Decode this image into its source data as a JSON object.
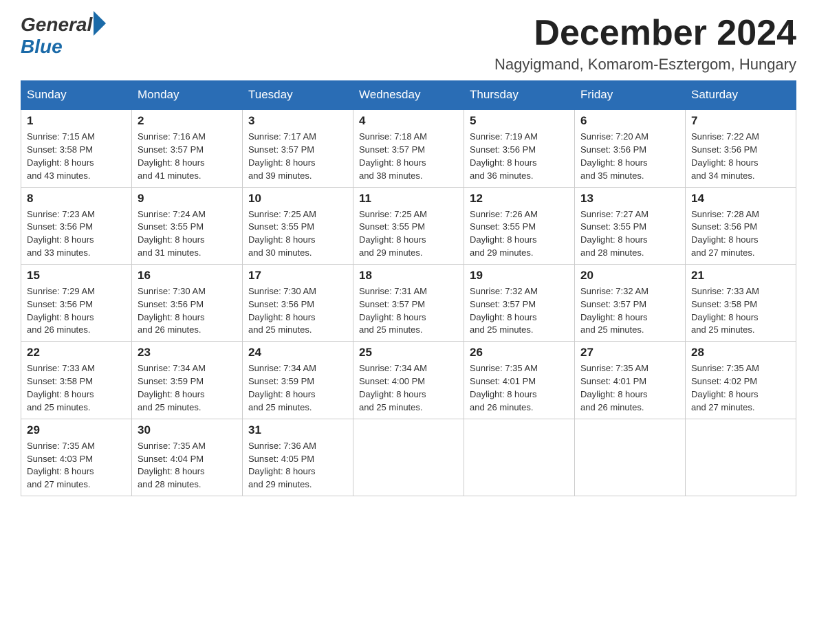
{
  "header": {
    "logo_general": "General",
    "logo_blue": "Blue",
    "month_title": "December 2024",
    "location": "Nagyigmand, Komarom-Esztergom, Hungary"
  },
  "weekdays": [
    "Sunday",
    "Monday",
    "Tuesday",
    "Wednesday",
    "Thursday",
    "Friday",
    "Saturday"
  ],
  "weeks": [
    [
      {
        "day": "1",
        "sunrise": "7:15 AM",
        "sunset": "3:58 PM",
        "daylight": "8 hours and 43 minutes."
      },
      {
        "day": "2",
        "sunrise": "7:16 AM",
        "sunset": "3:57 PM",
        "daylight": "8 hours and 41 minutes."
      },
      {
        "day": "3",
        "sunrise": "7:17 AM",
        "sunset": "3:57 PM",
        "daylight": "8 hours and 39 minutes."
      },
      {
        "day": "4",
        "sunrise": "7:18 AM",
        "sunset": "3:57 PM",
        "daylight": "8 hours and 38 minutes."
      },
      {
        "day": "5",
        "sunrise": "7:19 AM",
        "sunset": "3:56 PM",
        "daylight": "8 hours and 36 minutes."
      },
      {
        "day": "6",
        "sunrise": "7:20 AM",
        "sunset": "3:56 PM",
        "daylight": "8 hours and 35 minutes."
      },
      {
        "day": "7",
        "sunrise": "7:22 AM",
        "sunset": "3:56 PM",
        "daylight": "8 hours and 34 minutes."
      }
    ],
    [
      {
        "day": "8",
        "sunrise": "7:23 AM",
        "sunset": "3:56 PM",
        "daylight": "8 hours and 33 minutes."
      },
      {
        "day": "9",
        "sunrise": "7:24 AM",
        "sunset": "3:55 PM",
        "daylight": "8 hours and 31 minutes."
      },
      {
        "day": "10",
        "sunrise": "7:25 AM",
        "sunset": "3:55 PM",
        "daylight": "8 hours and 30 minutes."
      },
      {
        "day": "11",
        "sunrise": "7:25 AM",
        "sunset": "3:55 PM",
        "daylight": "8 hours and 29 minutes."
      },
      {
        "day": "12",
        "sunrise": "7:26 AM",
        "sunset": "3:55 PM",
        "daylight": "8 hours and 29 minutes."
      },
      {
        "day": "13",
        "sunrise": "7:27 AM",
        "sunset": "3:55 PM",
        "daylight": "8 hours and 28 minutes."
      },
      {
        "day": "14",
        "sunrise": "7:28 AM",
        "sunset": "3:56 PM",
        "daylight": "8 hours and 27 minutes."
      }
    ],
    [
      {
        "day": "15",
        "sunrise": "7:29 AM",
        "sunset": "3:56 PM",
        "daylight": "8 hours and 26 minutes."
      },
      {
        "day": "16",
        "sunrise": "7:30 AM",
        "sunset": "3:56 PM",
        "daylight": "8 hours and 26 minutes."
      },
      {
        "day": "17",
        "sunrise": "7:30 AM",
        "sunset": "3:56 PM",
        "daylight": "8 hours and 25 minutes."
      },
      {
        "day": "18",
        "sunrise": "7:31 AM",
        "sunset": "3:57 PM",
        "daylight": "8 hours and 25 minutes."
      },
      {
        "day": "19",
        "sunrise": "7:32 AM",
        "sunset": "3:57 PM",
        "daylight": "8 hours and 25 minutes."
      },
      {
        "day": "20",
        "sunrise": "7:32 AM",
        "sunset": "3:57 PM",
        "daylight": "8 hours and 25 minutes."
      },
      {
        "day": "21",
        "sunrise": "7:33 AM",
        "sunset": "3:58 PM",
        "daylight": "8 hours and 25 minutes."
      }
    ],
    [
      {
        "day": "22",
        "sunrise": "7:33 AM",
        "sunset": "3:58 PM",
        "daylight": "8 hours and 25 minutes."
      },
      {
        "day": "23",
        "sunrise": "7:34 AM",
        "sunset": "3:59 PM",
        "daylight": "8 hours and 25 minutes."
      },
      {
        "day": "24",
        "sunrise": "7:34 AM",
        "sunset": "3:59 PM",
        "daylight": "8 hours and 25 minutes."
      },
      {
        "day": "25",
        "sunrise": "7:34 AM",
        "sunset": "4:00 PM",
        "daylight": "8 hours and 25 minutes."
      },
      {
        "day": "26",
        "sunrise": "7:35 AM",
        "sunset": "4:01 PM",
        "daylight": "8 hours and 26 minutes."
      },
      {
        "day": "27",
        "sunrise": "7:35 AM",
        "sunset": "4:01 PM",
        "daylight": "8 hours and 26 minutes."
      },
      {
        "day": "28",
        "sunrise": "7:35 AM",
        "sunset": "4:02 PM",
        "daylight": "8 hours and 27 minutes."
      }
    ],
    [
      {
        "day": "29",
        "sunrise": "7:35 AM",
        "sunset": "4:03 PM",
        "daylight": "8 hours and 27 minutes."
      },
      {
        "day": "30",
        "sunrise": "7:35 AM",
        "sunset": "4:04 PM",
        "daylight": "8 hours and 28 minutes."
      },
      {
        "day": "31",
        "sunrise": "7:36 AM",
        "sunset": "4:05 PM",
        "daylight": "8 hours and 29 minutes."
      },
      null,
      null,
      null,
      null
    ]
  ],
  "labels": {
    "sunrise": "Sunrise:",
    "sunset": "Sunset:",
    "daylight": "Daylight:"
  }
}
